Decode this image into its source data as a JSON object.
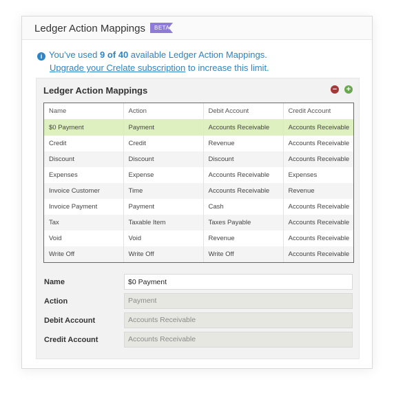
{
  "panel": {
    "title": "Ledger Action Mappings",
    "badge": "BETA"
  },
  "notice": {
    "icon": "info-icon",
    "prefix": "You’ve used",
    "used": "9 of 40",
    "suffix": "available Ledger Action Mappings.",
    "upgrade_link": "Upgrade your Crelate subscription",
    "upgrade_suffix": "to increase this limit."
  },
  "section": {
    "title": "Ledger Action Mappings",
    "remove_icon": "minus-circle-icon",
    "add_icon": "plus-circle-icon"
  },
  "table": {
    "headers": [
      "Name",
      "Action",
      "Debit Account",
      "Credit Account"
    ],
    "rows": [
      [
        "$0 Payment",
        "Payment",
        "Accounts Receivable",
        "Accounts Receivable"
      ],
      [
        "Credit",
        "Credit",
        "Revenue",
        "Accounts Receivable"
      ],
      [
        "Discount",
        "Discount",
        "Discount",
        "Accounts Receivable"
      ],
      [
        "Expenses",
        "Expense",
        "Accounts Receivable",
        "Expenses"
      ],
      [
        "Invoice Customer",
        "Time",
        "Accounts Receivable",
        "Revenue"
      ],
      [
        "Invoice Payment",
        "Payment",
        "Cash",
        "Accounts Receivable"
      ],
      [
        "Tax",
        "Taxable Item",
        "Taxes Payable",
        "Accounts Receivable"
      ],
      [
        "Void",
        "Void",
        "Revenue",
        "Accounts Receivable"
      ],
      [
        "Write Off",
        "Write Off",
        "Write Off",
        "Accounts Receivable"
      ]
    ],
    "selected_row": 0
  },
  "form": {
    "name_label": "Name",
    "name_value": "$0 Payment",
    "action_label": "Action",
    "action_value": "Payment",
    "debit_label": "Debit Account",
    "debit_value": "Accounts Receivable",
    "credit_label": "Credit Account",
    "credit_value": "Accounts Receivable"
  },
  "colors": {
    "accent": "#2d84c6",
    "badge": "#8e7bd6",
    "selected_row": "#dff0c0",
    "remove": "#a33a3a",
    "add": "#6aa84f"
  }
}
